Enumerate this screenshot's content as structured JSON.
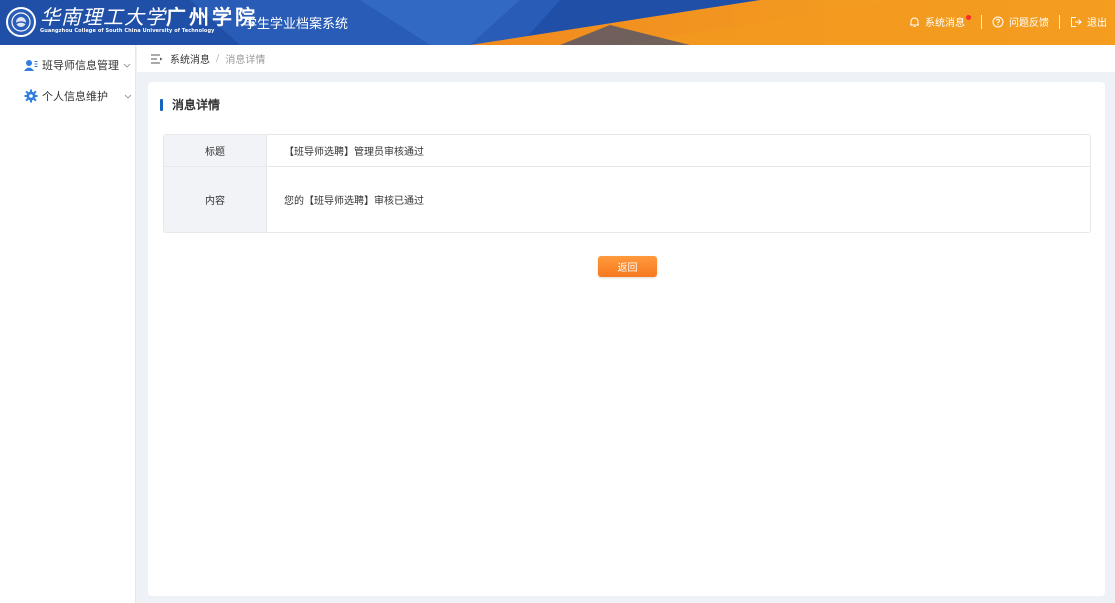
{
  "header": {
    "logo_cn_cursive": "华南理工大学",
    "logo_cn_bold": "广州学院",
    "logo_en": "Guangzhou College of South China University of Technology",
    "system_name": "学生学业档案系统",
    "messages_label": "系统消息",
    "feedback_label": "问题反馈",
    "logout_label": "退出",
    "has_unread": true
  },
  "sidebar": {
    "items": [
      {
        "label": "班导师信息管理",
        "icon": "user-group-icon"
      },
      {
        "label": "个人信息维护",
        "icon": "gear-icon"
      }
    ]
  },
  "breadcrumb": {
    "parent": "系统消息",
    "current": "消息详情"
  },
  "main": {
    "title": "消息详情",
    "fields": [
      {
        "key": "标题",
        "value": "【班导师选聘】管理员审核通过"
      },
      {
        "key": "内容",
        "value": "您的【班导师选聘】审核已通过"
      }
    ],
    "back_label": "返回"
  },
  "colors": {
    "header_blue": "#1f4fa6",
    "accent_orange": "#f7781f",
    "title_bar_blue": "#1565c0"
  }
}
